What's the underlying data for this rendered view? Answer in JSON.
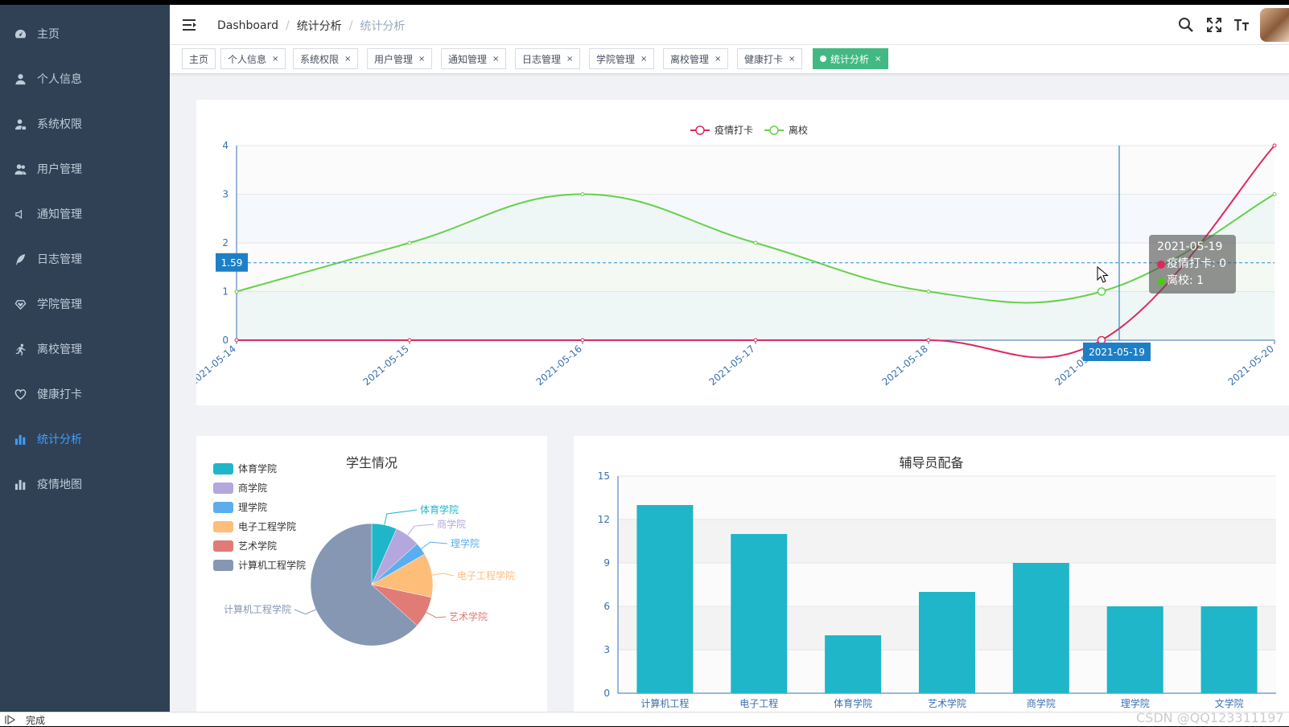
{
  "sidebar": {
    "items": [
      {
        "label": "主页",
        "icon": "dashboard-icon"
      },
      {
        "label": "个人信息",
        "icon": "user-icon"
      },
      {
        "label": "系统权限",
        "icon": "user-lock-icon"
      },
      {
        "label": "用户管理",
        "icon": "users-icon"
      },
      {
        "label": "通知管理",
        "icon": "speaker-icon"
      },
      {
        "label": "日志管理",
        "icon": "feather-icon"
      },
      {
        "label": "学院管理",
        "icon": "diamond-heart-icon"
      },
      {
        "label": "离校管理",
        "icon": "running-icon"
      },
      {
        "label": "健康打卡",
        "icon": "heart-icon"
      },
      {
        "label": "统计分析",
        "icon": "bar-chart-icon",
        "active": true
      },
      {
        "label": "疫情地图",
        "icon": "bar-chart-icon"
      }
    ]
  },
  "breadcrumb": [
    "Dashboard",
    "统计分析",
    "统计分析"
  ],
  "tags": [
    {
      "label": "主页",
      "closable": false
    },
    {
      "label": "个人信息",
      "closable": true
    },
    {
      "label": "系统权限",
      "closable": true
    },
    {
      "label": "用户管理",
      "closable": true
    },
    {
      "label": "通知管理",
      "closable": true
    },
    {
      "label": "日志管理",
      "closable": true
    },
    {
      "label": "学院管理",
      "closable": true
    },
    {
      "label": "离校管理",
      "closable": true
    },
    {
      "label": "健康打卡",
      "closable": true
    },
    {
      "label": "统计分析",
      "closable": true,
      "active": true
    }
  ],
  "tag_close_glyph": "×",
  "tooltip": {
    "date": "2021-05-19",
    "rows": [
      {
        "text": "疫情打卡: 0",
        "color": "#e0275d"
      },
      {
        "text": "离校: 1",
        "color": "#52c41a"
      }
    ]
  },
  "crosshair": {
    "y_value_label": "1.59",
    "x_value_label": "2021-05-19"
  },
  "status": {
    "text": "完成"
  },
  "watermark": "CSDN @QQ123311197",
  "colors": {
    "sidebar_bg": "#304156",
    "accent": "#409eff",
    "active_tag": "#42b983",
    "line_red": "#e0275d",
    "line_green": "#66d04a",
    "bar": "#1fb6c9"
  },
  "chart_data": [
    {
      "type": "line",
      "title": "",
      "x": [
        "2021-05-14",
        "2021-05-15",
        "2021-05-16",
        "2021-05-17",
        "2021-05-18",
        "2021-05-19",
        "2021-05-20"
      ],
      "series": [
        {
          "name": "疫情打卡",
          "values": [
            0,
            0,
            0,
            0,
            0,
            0,
            4
          ],
          "color": "#e0275d"
        },
        {
          "name": "离校",
          "values": [
            1,
            2,
            3,
            2,
            1,
            1,
            3
          ],
          "color": "#66d04a"
        }
      ],
      "ylim": [
        0,
        4
      ],
      "yticks": [
        0,
        1,
        2,
        3,
        4
      ],
      "legend": "top-center",
      "smooth": true
    },
    {
      "type": "pie",
      "title": "学生情况",
      "categories": [
        "体育学院",
        "商学院",
        "理学院",
        "电子工程学院",
        "艺术学院",
        "计算机工程学院"
      ],
      "values": [
        4,
        4,
        2,
        7,
        5,
        38
      ],
      "colors": [
        "#1fb6c9",
        "#b4a7dd",
        "#5aaef0",
        "#ffbd7a",
        "#e07b76",
        "#8697b3"
      ],
      "legend": "top-left"
    },
    {
      "type": "bar",
      "title": "辅导员配备",
      "categories": [
        "计算机工程",
        "电子工程",
        "体育学院",
        "艺术学院",
        "商学院",
        "理学院",
        "文学院"
      ],
      "values": [
        13,
        11,
        4,
        7,
        9,
        6,
        6
      ],
      "ylim": [
        0,
        15
      ],
      "yticks": [
        0,
        3,
        6,
        9,
        12,
        15
      ],
      "color": "#1fb6c9"
    }
  ]
}
